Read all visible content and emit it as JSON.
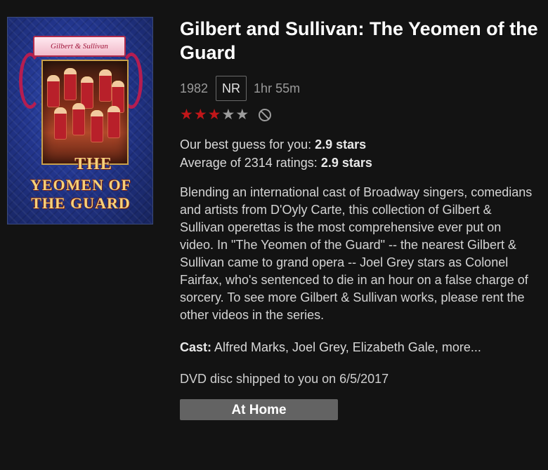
{
  "poster": {
    "banner_text": "Gilbert & Sullivan",
    "title_lines": [
      "YEOMEN OF",
      "THE GUARD"
    ],
    "title_prefix": "THE"
  },
  "movie": {
    "title": "Gilbert and Sullivan: The Yeomen of the Guard",
    "year": "1982",
    "maturity_rating": "NR",
    "duration": "1hr 55m",
    "star_rating": {
      "filled": 3,
      "total": 5,
      "filled_color": "#c11619",
      "empty_color": "#9d9d9d"
    },
    "best_guess_label": "Our best guess for you:",
    "best_guess_value": "2.9 stars",
    "average_label": "Average of 2314 ratings:",
    "average_value": "2.9 stars",
    "synopsis": "Blending an international cast of Broadway singers, comedians and artists from D'Oyly Carte, this collection of Gilbert & Sullivan operettas is the most comprehensive ever put on video. In \"The Yeomen of the Guard\" -- the nearest Gilbert & Sullivan came to grand opera -- Joel Grey stars as Colonel Fairfax, who's sentenced to die in an hour on a false charge of sorcery. To see more Gilbert & Sullivan works, please rent the other videos in the series.",
    "cast_label": "Cast:",
    "cast_names": "Alfred Marks, Joel Grey, Elizabeth Gale,",
    "cast_more": "more...",
    "shipped_text": "DVD disc shipped to you on 6/5/2017",
    "status_button": "At Home"
  },
  "icons": {
    "star": "star-icon",
    "not_interested": "not-interested-icon"
  }
}
